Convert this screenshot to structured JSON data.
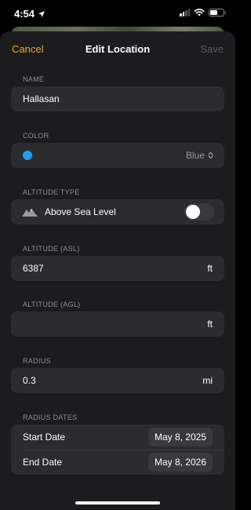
{
  "status": {
    "time": "4:54"
  },
  "nav": {
    "cancel": "Cancel",
    "title": "Edit Location",
    "save": "Save"
  },
  "name": {
    "label": "NAME",
    "value": "Hallasan"
  },
  "color": {
    "label": "COLOR",
    "value": "Blue",
    "swatch": "#1ea1f2"
  },
  "altitude_type": {
    "label": "ALTITUDE TYPE",
    "value": "Above Sea Level",
    "toggle_on": false
  },
  "altitude_asl": {
    "label": "ALTITUDE (ASL)",
    "value": "6387",
    "unit": "ft"
  },
  "altitude_agl": {
    "label": "ALTITUDE (AGL)",
    "value": "",
    "unit": "ft"
  },
  "radius": {
    "label": "RADIUS",
    "value": "0.3",
    "unit": "mi"
  },
  "radius_dates": {
    "label": "RADIUS DATES",
    "start_label": "Start Date",
    "start_value": "May 8, 2025",
    "end_label": "End Date",
    "end_value": "May 8, 2026"
  },
  "colors": {
    "accent": "#f0a71b",
    "background": "#1c1c1e",
    "field": "#2c2c2e"
  },
  "icons": {
    "location": "location-arrow-icon",
    "mountain": "mountain-icon",
    "chevron": "chevron-updown-icon"
  }
}
